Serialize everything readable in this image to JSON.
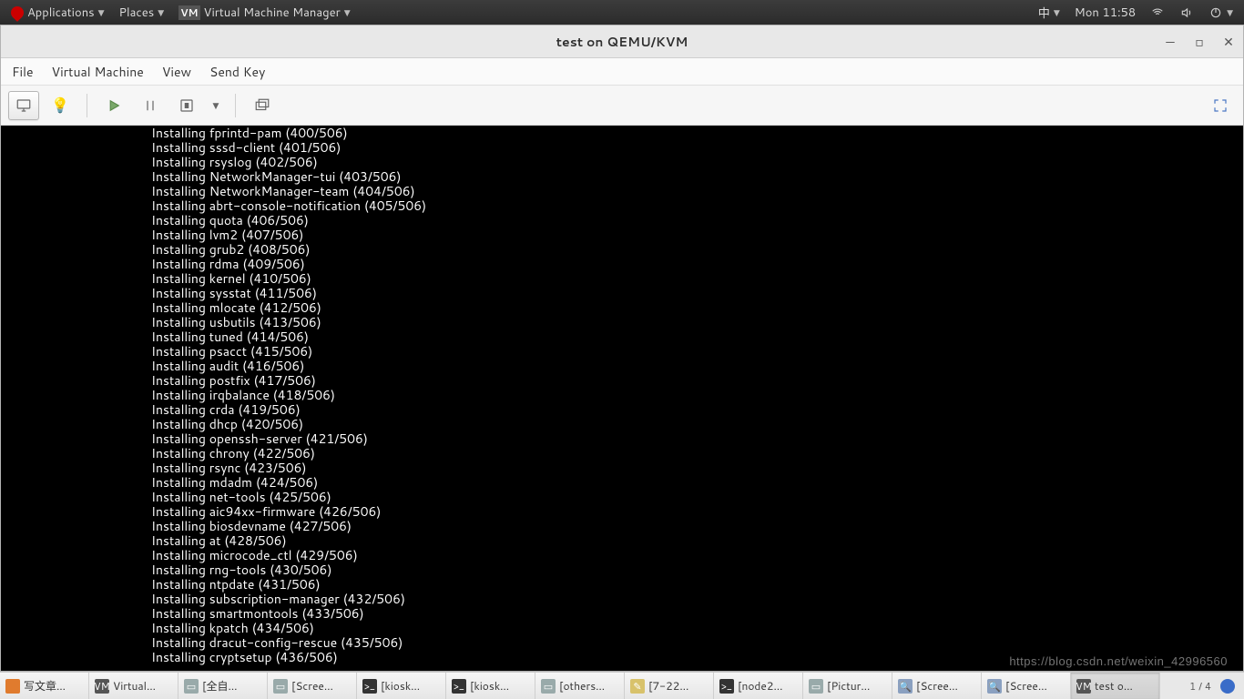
{
  "top_panel": {
    "applications": "Applications",
    "places": "Places",
    "active_app": "Virtual Machine Manager",
    "ime": "中",
    "clock": "Mon 11:58"
  },
  "window": {
    "title": "test on QEMU/KVM",
    "menus": [
      "File",
      "Virtual Machine",
      "View",
      "Send Key"
    ]
  },
  "console_lines": [
    "Installing fprintd-pam (400/506)",
    "Installing sssd-client (401/506)",
    "Installing rsyslog (402/506)",
    "Installing NetworkManager-tui (403/506)",
    "Installing NetworkManager-team (404/506)",
    "Installing abrt-console-notification (405/506)",
    "Installing quota (406/506)",
    "Installing lvm2 (407/506)",
    "Installing grub2 (408/506)",
    "Installing rdma (409/506)",
    "Installing kernel (410/506)",
    "Installing sysstat (411/506)",
    "Installing mlocate (412/506)",
    "Installing usbutils (413/506)",
    "Installing tuned (414/506)",
    "Installing psacct (415/506)",
    "Installing audit (416/506)",
    "Installing postfix (417/506)",
    "Installing irqbalance (418/506)",
    "Installing crda (419/506)",
    "Installing dhcp (420/506)",
    "Installing openssh-server (421/506)",
    "Installing chrony (422/506)",
    "Installing rsync (423/506)",
    "Installing mdadm (424/506)",
    "Installing net-tools (425/506)",
    "Installing aic94xx-firmware (426/506)",
    "Installing biosdevname (427/506)",
    "Installing at (428/506)",
    "Installing microcode_ctl (429/506)",
    "Installing rng-tools (430/506)",
    "Installing ntpdate (431/506)",
    "Installing subscription-manager (432/506)",
    "Installing smartmontools (433/506)",
    "Installing kpatch (434/506)",
    "Installing dracut-config-rescue (435/506)",
    "Installing cryptsetup (436/506)"
  ],
  "taskbar": {
    "items": [
      {
        "label": "写文章…",
        "icon_bg": "#e07b2e",
        "icon_txt": "",
        "name": "task-firefox"
      },
      {
        "label": "Virtual…",
        "icon_bg": "#555",
        "icon_txt": "VM",
        "name": "task-virt-manager"
      },
      {
        "label": "[全自…",
        "icon_bg": "#9aa",
        "icon_txt": "▭",
        "name": "task-doc"
      },
      {
        "label": "[Scree…",
        "icon_bg": "#9aa",
        "icon_txt": "▭",
        "name": "task-screenshot-1"
      },
      {
        "label": "[kiosk…",
        "icon_bg": "#333",
        "icon_txt": ">_",
        "name": "task-terminal-kiosk-1"
      },
      {
        "label": "[kiosk…",
        "icon_bg": "#333",
        "icon_txt": ">_",
        "name": "task-terminal-kiosk-2"
      },
      {
        "label": "[others…",
        "icon_bg": "#9aa",
        "icon_txt": "▭",
        "name": "task-others"
      },
      {
        "label": "[7-22…",
        "icon_bg": "#d8c26b",
        "icon_txt": "✎",
        "name": "task-gedit"
      },
      {
        "label": "[node2…",
        "icon_bg": "#333",
        "icon_txt": ">_",
        "name": "task-terminal-node2"
      },
      {
        "label": "[Pictur…",
        "icon_bg": "#9aa",
        "icon_txt": "▭",
        "name": "task-pictures"
      },
      {
        "label": "[Scree…",
        "icon_bg": "#8aa0c0",
        "icon_txt": "🔍",
        "name": "task-screenshot-2"
      },
      {
        "label": "[Scree…",
        "icon_bg": "#8aa0c0",
        "icon_txt": "🔍",
        "name": "task-screenshot-3"
      },
      {
        "label": "test o…",
        "icon_bg": "#555",
        "icon_txt": "VM",
        "name": "task-vm-test",
        "active": true
      }
    ],
    "tray": "1 / 4"
  },
  "watermark": "https://blog.csdn.net/weixin_42996560"
}
